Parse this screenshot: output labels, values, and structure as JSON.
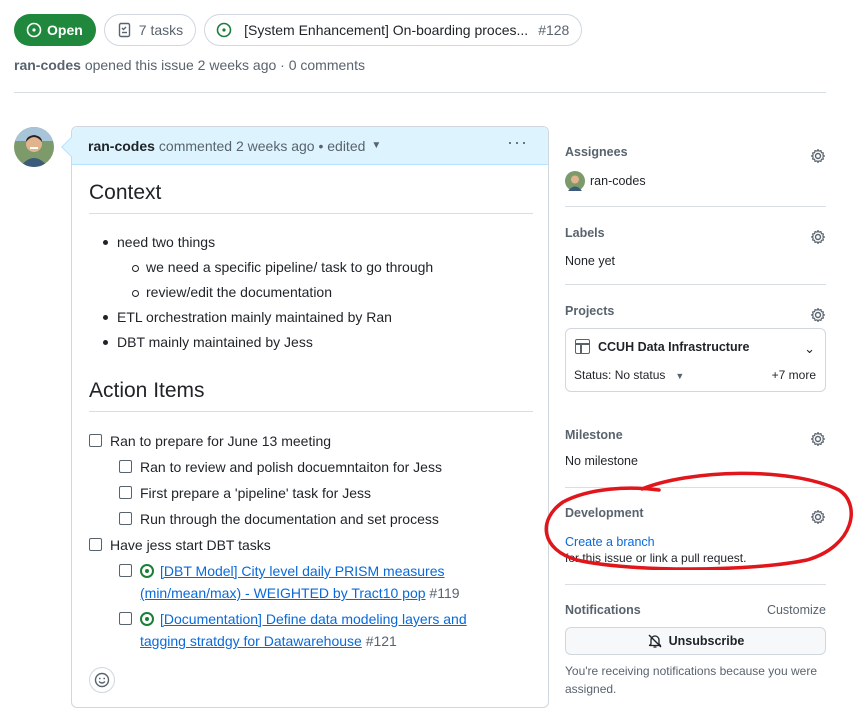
{
  "header": {
    "state_label": "Open",
    "tasks_label": "7 tasks",
    "parent_title": "[System Enhancement] On-boarding proces...",
    "parent_number": "#128",
    "author": "ran-codes",
    "opened_text": "opened this issue 2 weeks ago · 0 comments"
  },
  "comment": {
    "author": "ran-codes",
    "meta": "commented 2 weeks ago • edited",
    "sections": {
      "context_title": "Context",
      "action_title": "Action Items"
    },
    "context_items": {
      "a": "need two things",
      "a1": "we need a specific pipeline/ task to go through",
      "a2": "review/edit the documentation",
      "b": "ETL orchestration mainly maintained by Ran",
      "c": "DBT mainly maintained by Jess"
    },
    "tasks": {
      "t1": "Ran to prepare for June 13 meeting",
      "t1a": "Ran to review and polish docuemntaiton for Jess",
      "t1b": "First prepare a 'pipeline' task for Jess",
      "t1c": "Run through the documentation and set process",
      "t2": "Have jess start DBT tasks",
      "t2a_title_1": "[DBT Model] City level daily PRISM measures",
      "t2a_title_2": "(min/mean/max) - WEIGHTED by Tract10 pop",
      "t2a_num": "#119",
      "t2b_title_1": "[Documentation] Define data modeling layers and",
      "t2b_title_2": "tagging stratdgy for Datawarehouse",
      "t2b_num": "#121"
    }
  },
  "sidebar": {
    "assignees_title": "Assignees",
    "assignee": "ran-codes",
    "labels_title": "Labels",
    "labels_value": "None yet",
    "projects_title": "Projects",
    "project_name": "CCUH Data Infrastructure",
    "project_status": "Status: No status",
    "project_more": "+7 more",
    "milestone_title": "Milestone",
    "milestone_value": "No milestone",
    "development_title": "Development",
    "development_link": "Create a branch",
    "development_text": "for this issue or link a pull request.",
    "notifications_title": "Notifications",
    "customize_label": "Customize",
    "unsubscribe_label": "Unsubscribe",
    "notification_note": "You're receiving notifications because you were assigned."
  },
  "colors": {
    "open_green": "#1f883d",
    "link_blue": "#0969da",
    "annotation_red": "#e0161b"
  }
}
